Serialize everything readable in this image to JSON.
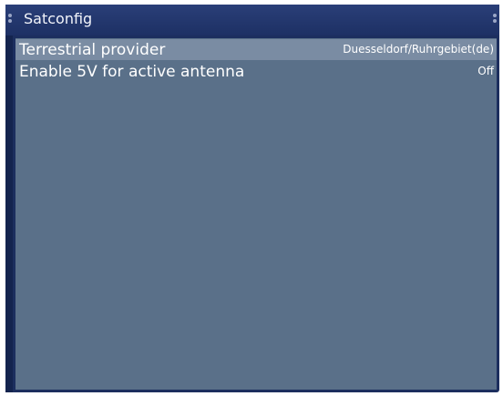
{
  "window": {
    "title": "Satconfig"
  },
  "settings": [
    {
      "label": "Terrestrial provider",
      "value": "Duesseldorf/Ruhrgebiet(de)"
    },
    {
      "label": "Enable 5V for active antenna",
      "value": "Off"
    }
  ],
  "colors": {
    "frame": "#1c2e5e",
    "content_bg": "#5a7089",
    "selected_row": "#7a8ca3",
    "text": "#ffffff"
  }
}
